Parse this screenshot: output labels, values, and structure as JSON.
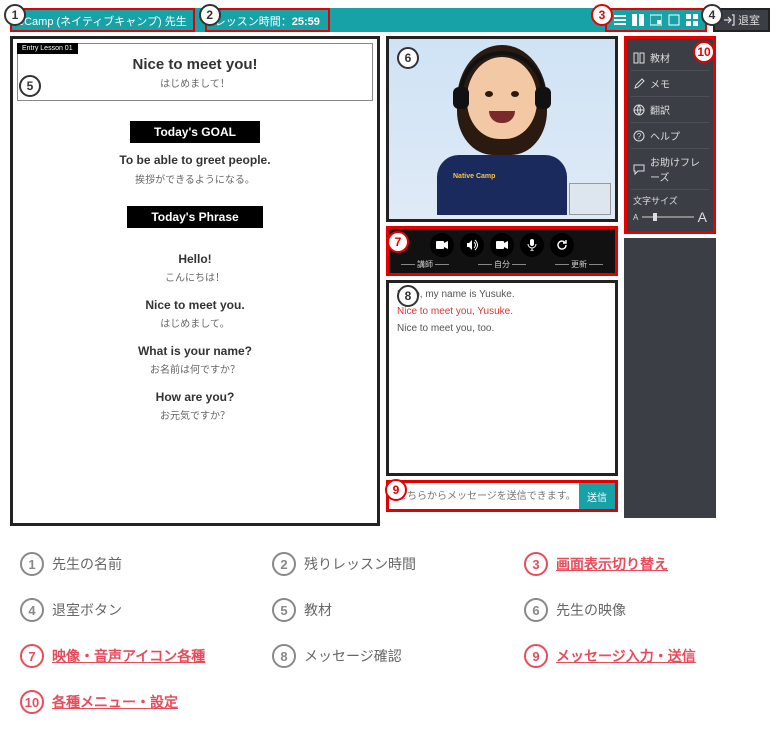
{
  "header": {
    "teacher_label": "eCamp (ネイティブキャンプ) 先生",
    "timer_label": "レッスン時間：",
    "timer_value": "25:59",
    "exit_label": "退室"
  },
  "material": {
    "entry_tag": "Entry Lesson 01",
    "title_en": "Nice to meet you!",
    "title_jp": "はじめまして！",
    "goal_band": "Today's GOAL",
    "goal_en": "To be able to greet people.",
    "goal_jp": "挨拶ができるようになる。",
    "phrase_band": "Today's Phrase",
    "phrases": [
      {
        "en": "Hello!",
        "jp": "こんにちは！"
      },
      {
        "en": "Nice to meet you.",
        "jp": "はじめまして。"
      },
      {
        "en": "What is your name?",
        "jp": "お名前は何ですか？"
      },
      {
        "en": "How are you?",
        "jp": "お元気ですか？"
      }
    ]
  },
  "video": {
    "shirt_logo": "Native\nCamp"
  },
  "controls": {
    "group_instructor": "講師",
    "group_self": "自分",
    "group_refresh": "更新"
  },
  "chat": {
    "lines": [
      {
        "text": "Hello, my name is Yusuke.",
        "red": false
      },
      {
        "text": "Nice to meet you, Yusuke.",
        "red": true
      },
      {
        "text": "Nice to meet you, too.",
        "red": false
      }
    ],
    "placeholder": "こちらからメッセージを送信できます。",
    "send_label": "送信"
  },
  "side": {
    "items": [
      {
        "label": "教材",
        "icon": "book"
      },
      {
        "label": "メモ",
        "icon": "edit"
      },
      {
        "label": "翻訳",
        "icon": "globe"
      },
      {
        "label": "ヘルプ",
        "icon": "help"
      },
      {
        "label": "お助けフレーズ",
        "icon": "chat"
      }
    ],
    "textsize_label": "文字サイズ"
  },
  "legend": {
    "items": [
      {
        "n": "1",
        "text": "先生の名前",
        "red": false
      },
      {
        "n": "2",
        "text": "残りレッスン時間",
        "red": false
      },
      {
        "n": "3",
        "text": "画面表示切り替え",
        "red": true
      },
      {
        "n": "4",
        "text": "退室ボタン",
        "red": false
      },
      {
        "n": "5",
        "text": "教材",
        "red": false
      },
      {
        "n": "6",
        "text": "先生の映像",
        "red": false
      },
      {
        "n": "7",
        "text": "映像・音声アイコン各種",
        "red": true
      },
      {
        "n": "8",
        "text": "メッセージ確認",
        "red": false
      },
      {
        "n": "9",
        "text": "メッセージ入力・送信",
        "red": true
      },
      {
        "n": "10",
        "text": "各種メニュー・設定",
        "red": true
      }
    ]
  },
  "markers": {
    "m1": "1",
    "m2": "2",
    "m3": "3",
    "m4": "4",
    "m5": "5",
    "m6": "6",
    "m7": "7",
    "m8": "8",
    "m9": "9",
    "m10": "10"
  }
}
